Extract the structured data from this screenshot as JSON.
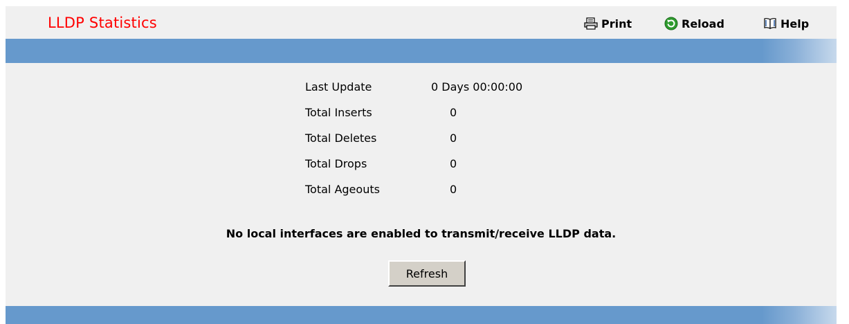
{
  "header": {
    "title": "LLDP Statistics",
    "print_label": "Print",
    "reload_label": "Reload",
    "help_label": "Help",
    "icons": {
      "print": "printer-icon",
      "reload": "reload-icon",
      "help": "book-icon"
    }
  },
  "stats": [
    {
      "label": "Last Update",
      "value": "0 Days 00:00:00"
    },
    {
      "label": "Total Inserts",
      "value": "0"
    },
    {
      "label": "Total Deletes",
      "value": "0"
    },
    {
      "label": "Total Drops",
      "value": "0"
    },
    {
      "label": "Total Ageouts",
      "value": "0"
    }
  ],
  "notice": "No local interfaces are enabled to transmit/receive LLDP data.",
  "refresh_label": "Refresh",
  "colors": {
    "title": "#ff0000",
    "band": "#6699cc",
    "background": "#f0f0f0",
    "reload_icon": "#2e9b2e"
  }
}
